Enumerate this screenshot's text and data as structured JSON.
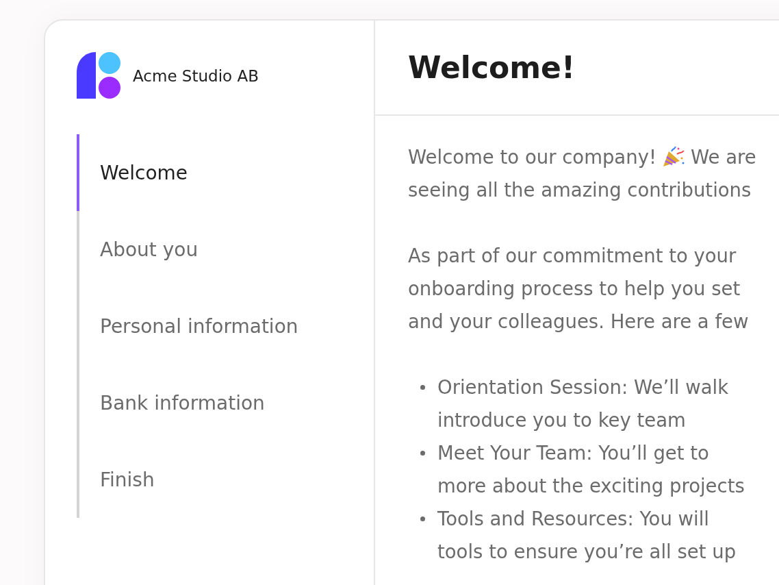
{
  "brand": {
    "name": "Acme Studio AB"
  },
  "steps": [
    {
      "label": "Welcome",
      "selected": true
    },
    {
      "label": "About you",
      "selected": false
    },
    {
      "label": "Personal information",
      "selected": false
    },
    {
      "label": "Bank information",
      "selected": false
    },
    {
      "label": "Finish",
      "selected": false
    }
  ],
  "page": {
    "title": "Welcome!"
  },
  "intro": {
    "before_icon": "Welcome to our company!",
    "after_icon": "We are",
    "lines": [
      "seeing all the amazing contributions"
    ]
  },
  "paragraph": {
    "lines": [
      "As part of our commitment to your",
      "onboarding process to help you set",
      "and your colleagues. Here are a few"
    ]
  },
  "bullets": [
    {
      "lines": [
        "Orientation Session: We’ll walk",
        "introduce you to key team"
      ]
    },
    {
      "lines": [
        "Meet Your Team: You’ll get to",
        "more about the exciting projects"
      ]
    },
    {
      "lines": [
        "Tools and Resources: You will",
        "tools to ensure you’re all set up"
      ]
    }
  ]
}
